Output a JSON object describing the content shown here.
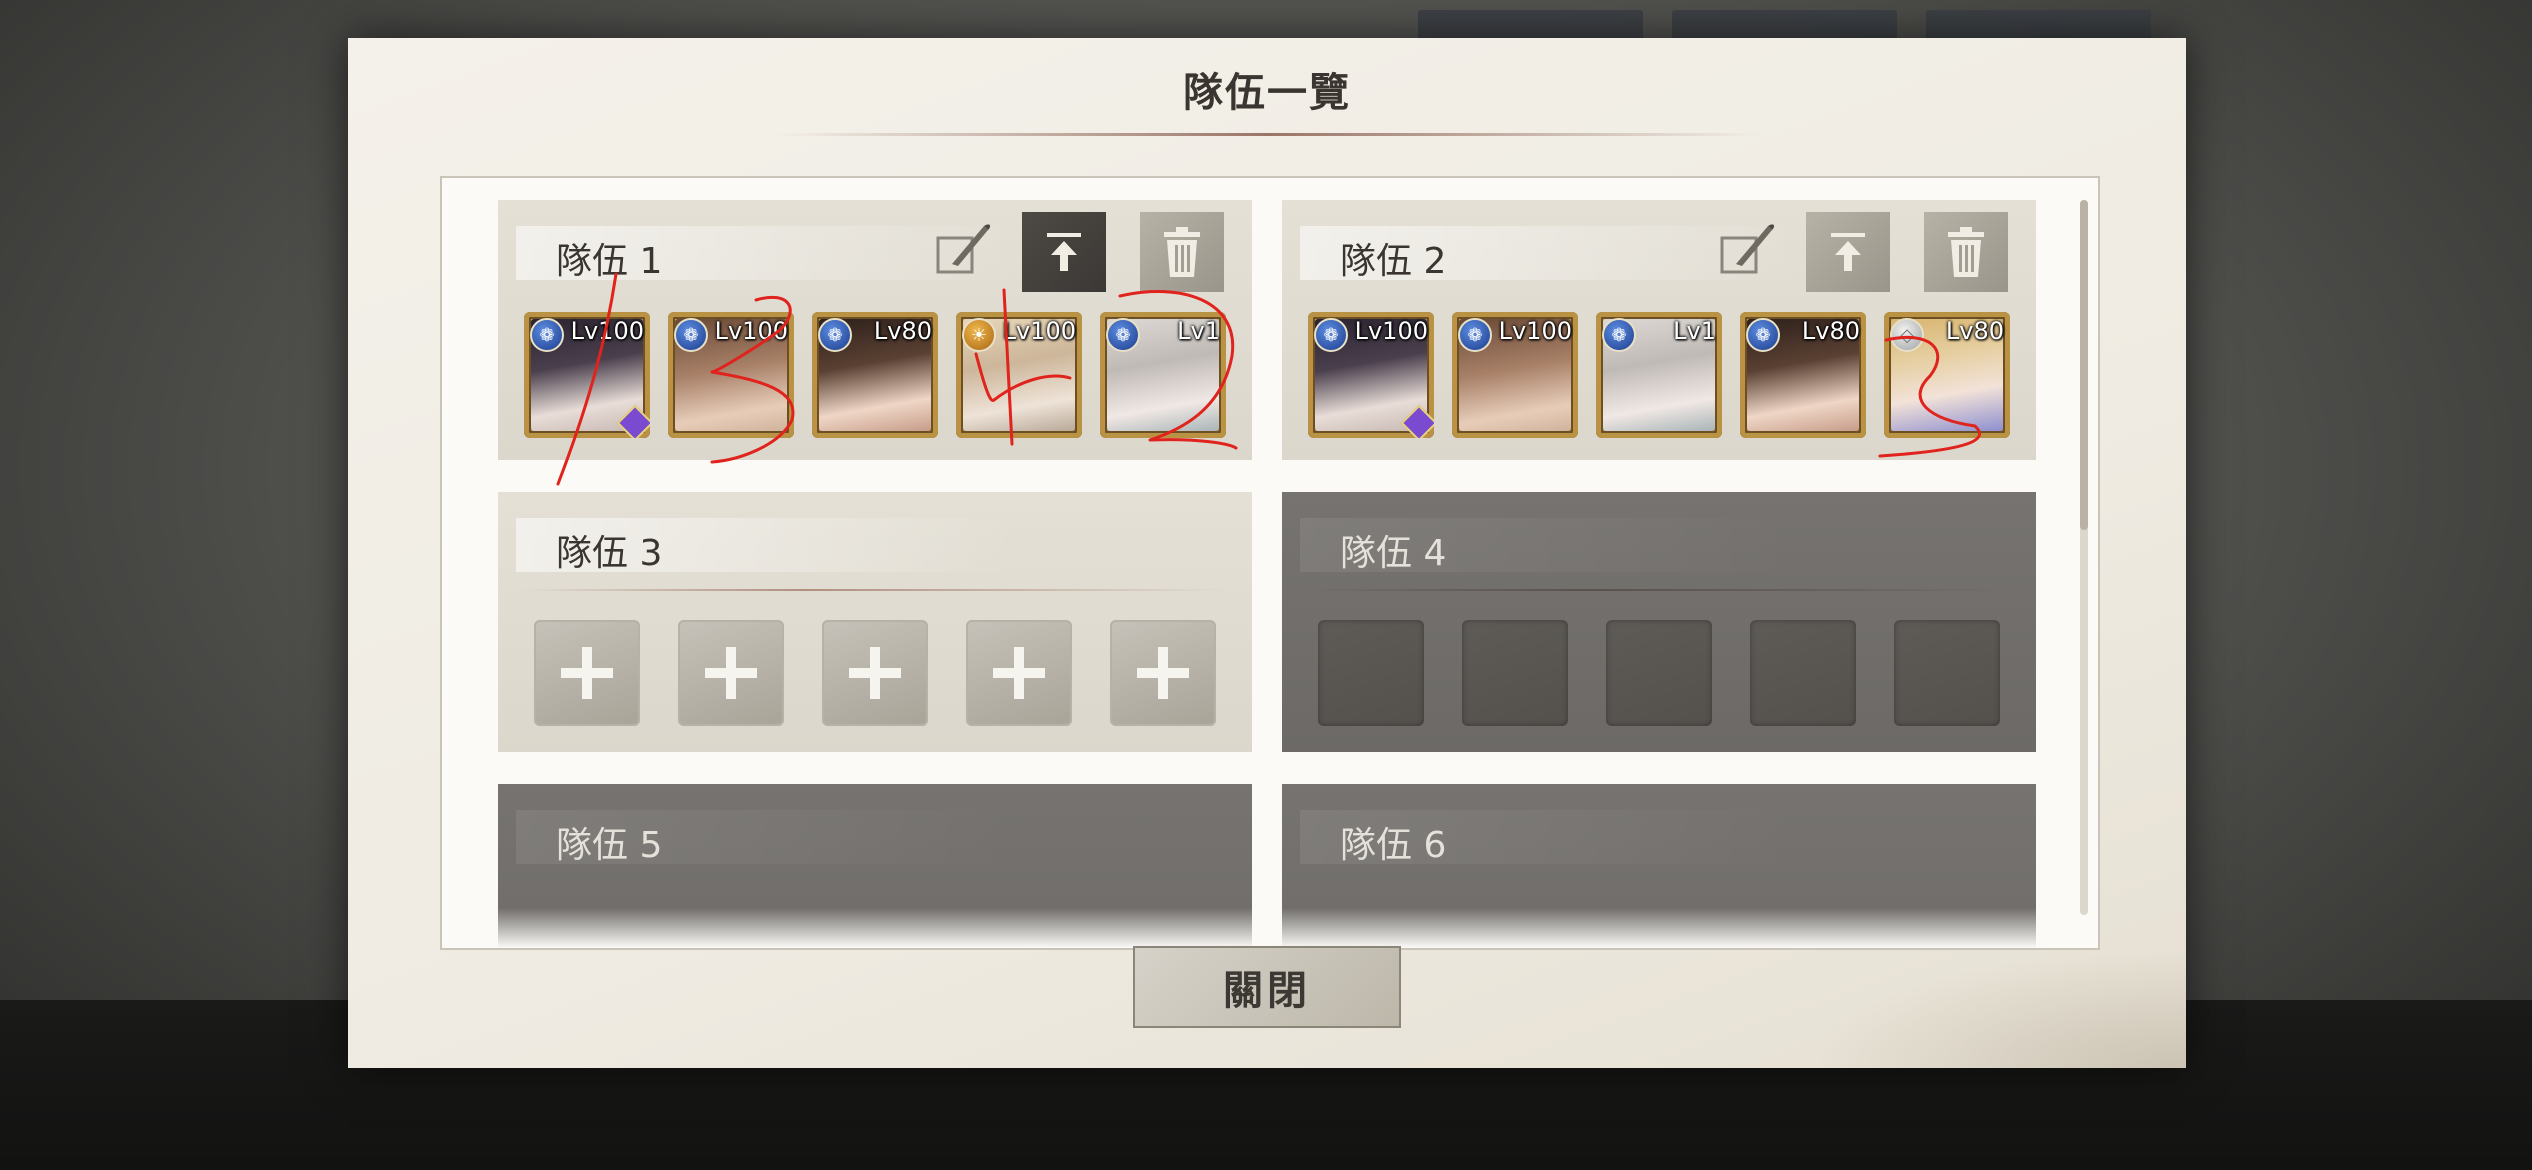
{
  "dialog": {
    "title": "隊伍一覽",
    "close_label": "關閉"
  },
  "teams": [
    {
      "name": "隊伍 1",
      "state": "active",
      "members": [
        {
          "level": "Lv100",
          "element": "water-icon",
          "has_gem": true
        },
        {
          "level": "Lv100",
          "element": "water-icon",
          "has_gem": false
        },
        {
          "level": "Lv80",
          "element": "water-icon",
          "has_gem": false
        },
        {
          "level": "Lv100",
          "element": "sun-icon",
          "has_gem": false
        },
        {
          "level": "Lv1",
          "element": "water-icon",
          "has_gem": false
        }
      ]
    },
    {
      "name": "隊伍 2",
      "state": "active",
      "members": [
        {
          "level": "Lv100",
          "element": "water-icon",
          "has_gem": true
        },
        {
          "level": "Lv100",
          "element": "water-icon",
          "has_gem": false
        },
        {
          "level": "Lv1",
          "element": "water-icon",
          "has_gem": false
        },
        {
          "level": "Lv80",
          "element": "water-icon",
          "has_gem": false
        },
        {
          "level": "Lv80",
          "element": "diamond-icon",
          "has_gem": false
        }
      ]
    },
    {
      "name": "隊伍 3",
      "state": "empty-editable"
    },
    {
      "name": "隊伍 4",
      "state": "locked"
    },
    {
      "name": "隊伍 5",
      "state": "locked"
    },
    {
      "name": "隊伍 6",
      "state": "locked"
    }
  ],
  "icons": {
    "edit": "quill-edit-icon",
    "set_top": "arrow-up-to-top-icon",
    "delete": "trash-icon",
    "add": "plus-icon"
  },
  "colors": {
    "annotation_red": "#e0231c",
    "frame_gold": "#b99343",
    "element_blue": "#1b3c8d"
  }
}
